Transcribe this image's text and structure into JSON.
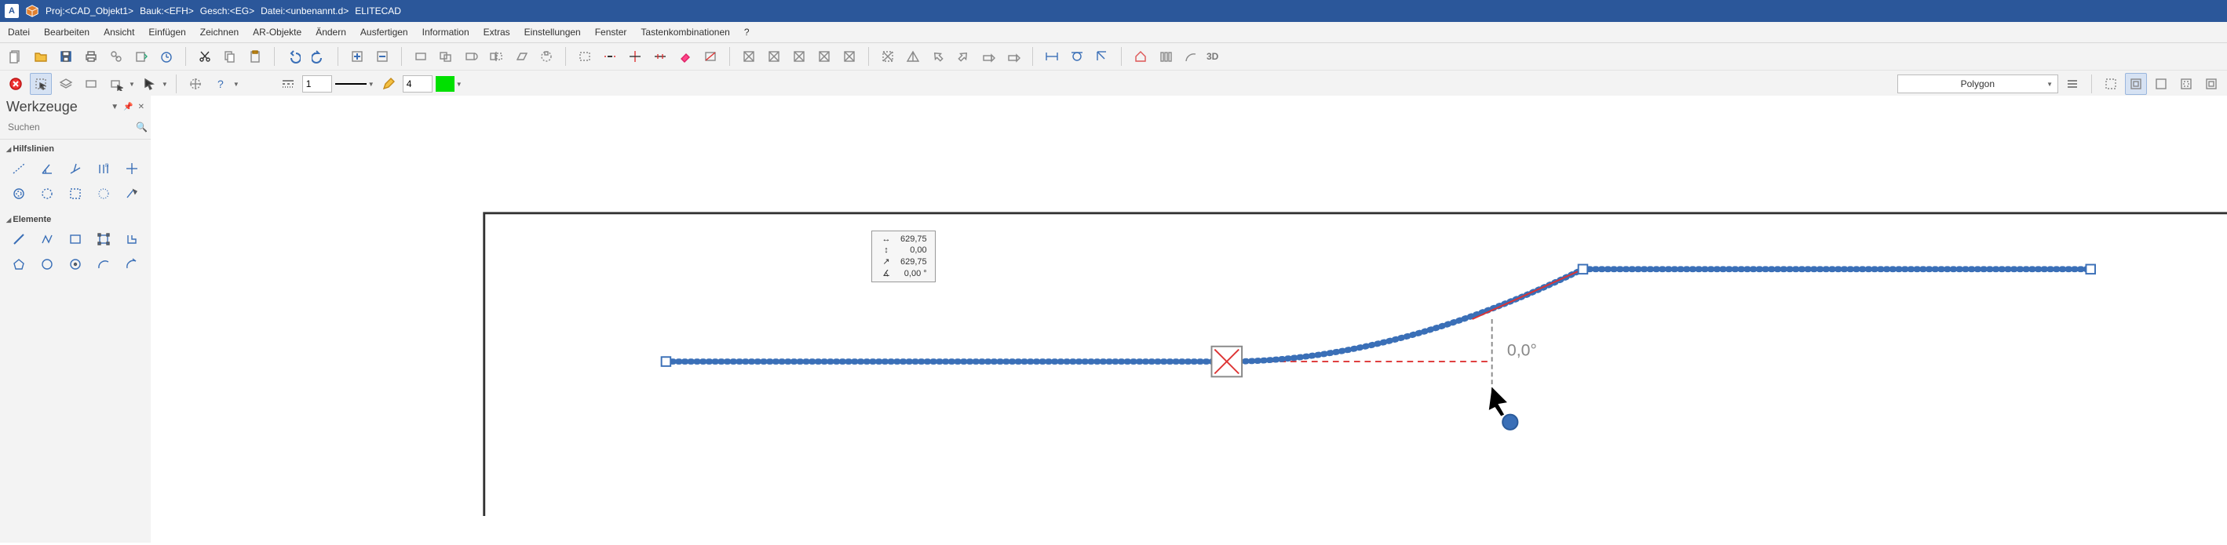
{
  "titlebar": {
    "app_letter": "A",
    "proj": "Proj:<CAD_Objekt1>",
    "bauk": "Bauk:<EFH>",
    "gesch": "Gesch:<EG>",
    "datei": "Datei:<unbenannt.d>",
    "product": "ELITECAD"
  },
  "menu": {
    "datei": "Datei",
    "bearbeiten": "Bearbeiten",
    "ansicht": "Ansicht",
    "einfuegen": "Einfügen",
    "zeichnen": "Zeichnen",
    "ar_objekte": "AR-Objekte",
    "aendern": "Ändern",
    "ausfertigen": "Ausfertigen",
    "information": "Information",
    "extras": "Extras",
    "einstellungen": "Einstellungen",
    "fenster": "Fenster",
    "tasten": "Tastenkombinationen",
    "help": "?"
  },
  "toolbar1_icons": {
    "new": "new-file-icon",
    "open": "open-folder-icon",
    "save": "save-icon",
    "print": "print-icon",
    "copyprops": "copy-props-icon",
    "pasteprops": "paste-props-icon",
    "timer": "timer-icon",
    "cut": "cut-icon",
    "copy": "copy-icon",
    "paste": "paste-icon",
    "undo": "undo-icon",
    "redo": "redo-icon",
    "plus": "plus-box-icon",
    "minus": "minus-box-icon",
    "rect": "rect-icon",
    "rects": "rects-icon",
    "rotrect": "rotate-rect-icon",
    "flip": "flip-icon",
    "skew": "skew-icon",
    "rotpattern": "rotate-pattern-icon",
    "seldash": "select-dash-icon",
    "trim": "trim-icon",
    "extend": "extend-icon",
    "divide": "divide-icon",
    "eraser": "eraser-icon",
    "eraseline": "erase-line-icon",
    "hatch_group": "hatch-icons",
    "pyramid": "pyramid-icon",
    "arrows_group": "arrow-view-icons",
    "dim1": "dim-1-icon",
    "dim2": "dim-2-icon",
    "dim3": "dim-3-icon",
    "house": "house-icon",
    "columns": "columns-icon",
    "arc3d": "arc-3d-icon",
    "label3d": "3D"
  },
  "toolbar2": {
    "cancel": "cancel-icon",
    "select": "select-icon",
    "layers": "layers-icon",
    "view": "view-rect-icon",
    "viewpick": "view-pick-icon",
    "cursor": "cursor-icon",
    "reticle": "reticle-icon",
    "help": "help-icon",
    "linetype": "linetype-icon",
    "linetype_value": "1",
    "linepreview": "line-preview",
    "pen": "pen-icon",
    "pen_value": "4",
    "color_hex": "#00e000",
    "polygon_label": "Polygon",
    "mode_icons": "polygon-mode-icons"
  },
  "tools_panel": {
    "title": "Werkzeuge",
    "search_placeholder": "Suchen",
    "section_hilfslinien": "Hilfslinien",
    "section_elemente": "Elemente",
    "hilfslinien_icons": [
      "construction-line-icon",
      "angle-line-icon",
      "perp-line-icon",
      "n-line-icon",
      "cross-icon",
      "circle-aux-icon",
      "arc-aux-icon",
      "dash-circle-icon",
      "dash-arc-icon",
      "tangent-icon"
    ],
    "elemente_icons": [
      "line-icon",
      "polyline-icon",
      "rectangle-icon",
      "rect-handles-icon",
      "angle-shape-icon",
      "polygon-icon",
      "circle-icon",
      "circle-center-icon",
      "arc-icon",
      "arc-tangent-icon"
    ]
  },
  "canvas": {
    "angle_label": "0,0°",
    "coords": {
      "dx": "629,75",
      "dy": "0,00",
      "dist": "629,75",
      "ang": "0,00 °"
    }
  }
}
